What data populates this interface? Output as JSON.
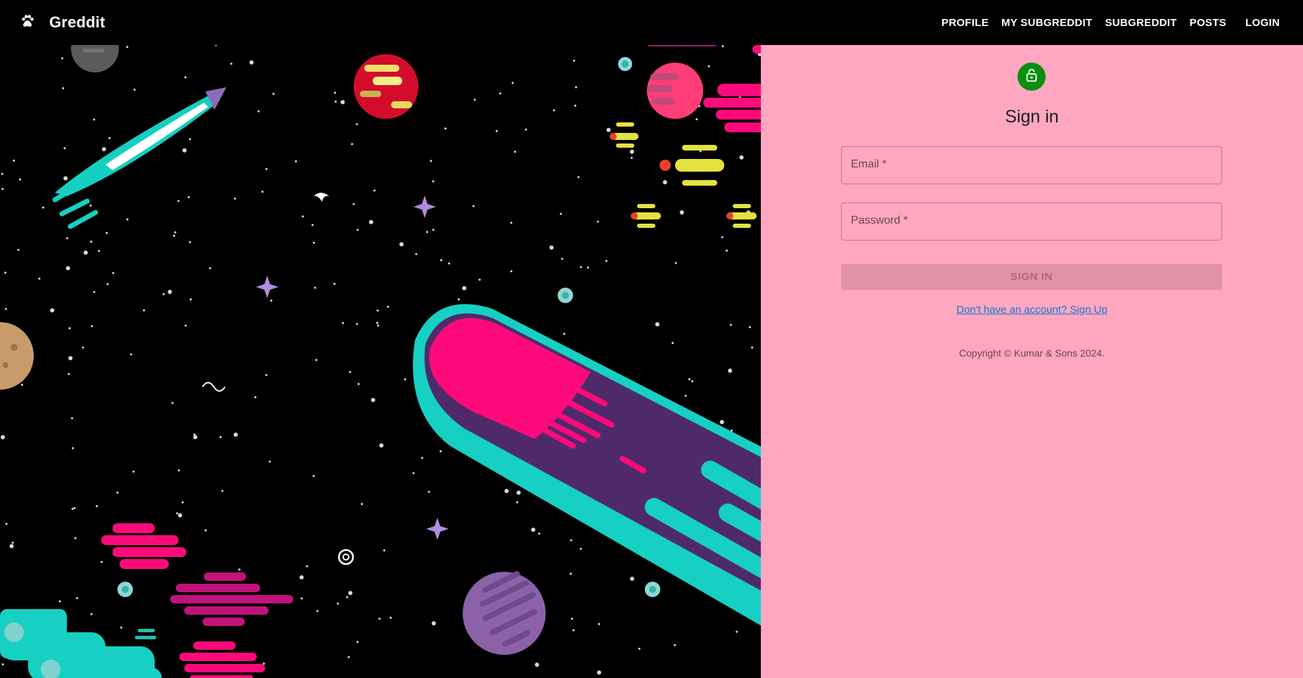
{
  "appbar": {
    "brand": "Greddit",
    "nav": [
      "PROFILE",
      "MY SUBGREDDIT",
      "SUBGREDDIT",
      "POSTS",
      "LOGIN"
    ]
  },
  "signin": {
    "title": "Sign in",
    "email_label": "Email *",
    "password_label": "Password *",
    "submit_label": "SIGN IN",
    "signup_link": "Don't have an account? Sign Up",
    "copyright": "Copyright © Kumar & Sons 2024."
  },
  "colors": {
    "appbar": "#000000",
    "panel": "#ffa7c1",
    "avatar": "#0a8f10",
    "link": "#1976d2",
    "teal": "#16d0c3",
    "magenta": "#ff0a7a",
    "purple": "#4f2a6b"
  },
  "icons": {
    "brand": "paw-icon",
    "avatar": "lock-icon"
  }
}
